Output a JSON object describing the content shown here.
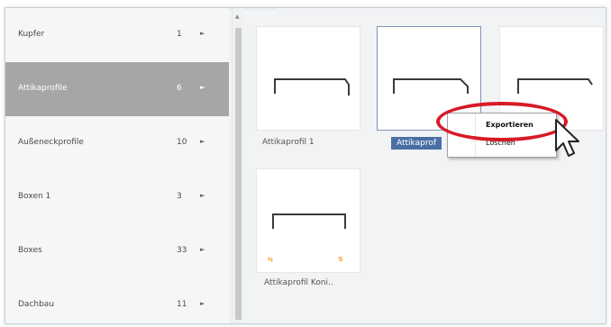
{
  "sidebar": {
    "items": [
      {
        "label": "Kupfer",
        "count": "1",
        "arrow": "►"
      },
      {
        "label": "Attikaprofile",
        "count": "6",
        "arrow": "►"
      },
      {
        "label": "Außeneckprofile",
        "count": "10",
        "arrow": "►"
      },
      {
        "label": "Boxen 1",
        "count": "3",
        "arrow": "►"
      },
      {
        "label": "Boxes",
        "count": "33",
        "arrow": "►"
      },
      {
        "label": "Dachbau",
        "count": "11",
        "arrow": "►"
      }
    ],
    "selected_index": 1
  },
  "scrollbar": {
    "up_arrow": "▲"
  },
  "tiles": [
    {
      "caption": "Attikaprofil 1"
    },
    {
      "caption": "Attikaprof"
    },
    {
      "caption": ""
    },
    {
      "caption": "Attikaprofil Koni..",
      "marker_left": "⇆",
      "marker_right": "⇅"
    }
  ],
  "context_menu": {
    "items": [
      {
        "label": "Exportieren"
      },
      {
        "label": "Löschen"
      }
    ]
  },
  "colors": {
    "selected_category": "#a6a6a6",
    "selected_caption": "#4a6fa5",
    "highlight_ellipse": "#d81a27",
    "profile_stroke": "#3a3a3a"
  },
  "icons": {
    "cursor": "arrow-cursor-icon",
    "submenu": "chevron-right-icon"
  }
}
